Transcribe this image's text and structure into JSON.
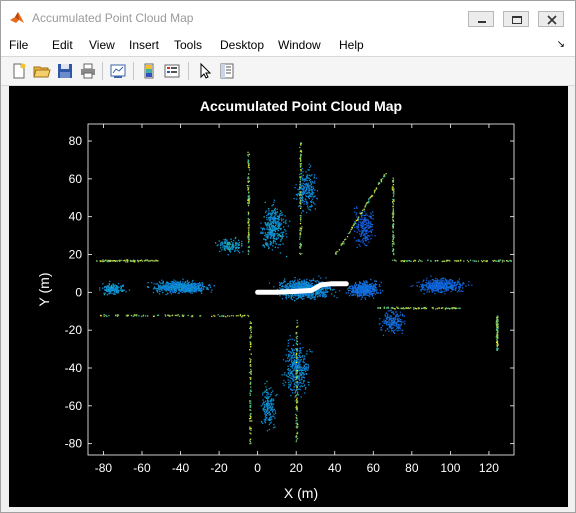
{
  "window": {
    "title": "Accumulated Point Cloud Map"
  },
  "menu": {
    "items": [
      "File",
      "Edit",
      "View",
      "Insert",
      "Tools",
      "Desktop",
      "Window",
      "Help"
    ],
    "overflow_arrow": "↘"
  },
  "toolbar": {
    "icons": [
      "new-figure-icon",
      "open-file-icon",
      "save-icon",
      "print-icon",
      "link-plot-icon",
      "insert-colorbar-icon",
      "insert-legend-icon",
      "pointer-edit-icon",
      "property-inspector-icon"
    ]
  },
  "chart_data": {
    "type": "scatter",
    "title": "Accumulated Point Cloud Map",
    "xlabel": "X (m)",
    "ylabel": "Y (m)",
    "xlim": [
      -88,
      133
    ],
    "ylim": [
      -86,
      89
    ],
    "xticks": [
      -80,
      -60,
      -40,
      -20,
      0,
      20,
      40,
      60,
      80,
      100,
      120
    ],
    "yticks": [
      -80,
      -60,
      -40,
      -20,
      0,
      20,
      40,
      60,
      80
    ],
    "background": "#000000",
    "colormap": "parula",
    "trajectory": {
      "color": "#ffffff",
      "x": [
        0,
        10,
        20,
        28,
        33,
        38,
        46
      ],
      "y": [
        0,
        0,
        0.5,
        1,
        4,
        4.5,
        4.5
      ]
    },
    "structures": [
      {
        "name": "left-road-edge-upper",
        "x": [
          -84,
          -52
        ],
        "y": [
          17,
          17
        ]
      },
      {
        "name": "left-road-edge-lower",
        "x": [
          -82,
          -5
        ],
        "y": [
          -12,
          -12
        ]
      },
      {
        "name": "vertical-wall-left-upper",
        "x": [
          -5,
          -5
        ],
        "y": [
          20,
          75
        ]
      },
      {
        "name": "vertical-wall-left-lower",
        "x": [
          -4,
          -4
        ],
        "y": [
          -15,
          -80
        ]
      },
      {
        "name": "vertical-wall-mid",
        "x": [
          20,
          20
        ],
        "y": [
          -15,
          -80
        ]
      },
      {
        "name": "vertical-wall-top-mid",
        "x": [
          22,
          22
        ],
        "y": [
          20,
          80
        ]
      },
      {
        "name": "right-building",
        "x": [
          40,
          66
        ],
        "y": [
          20,
          63
        ]
      },
      {
        "name": "right-road-edge-upper",
        "x": [
          68,
          132
        ],
        "y": [
          17,
          17
        ]
      },
      {
        "name": "right-road-edge-lower",
        "x": [
          62,
          105
        ],
        "y": [
          -8,
          -8
        ]
      },
      {
        "name": "vertical-wall-right",
        "x": [
          70,
          70
        ],
        "y": [
          20,
          62
        ]
      },
      {
        "name": "vertical-post-far-right",
        "x": [
          124,
          124
        ],
        "y": [
          -12,
          -30
        ]
      }
    ]
  }
}
